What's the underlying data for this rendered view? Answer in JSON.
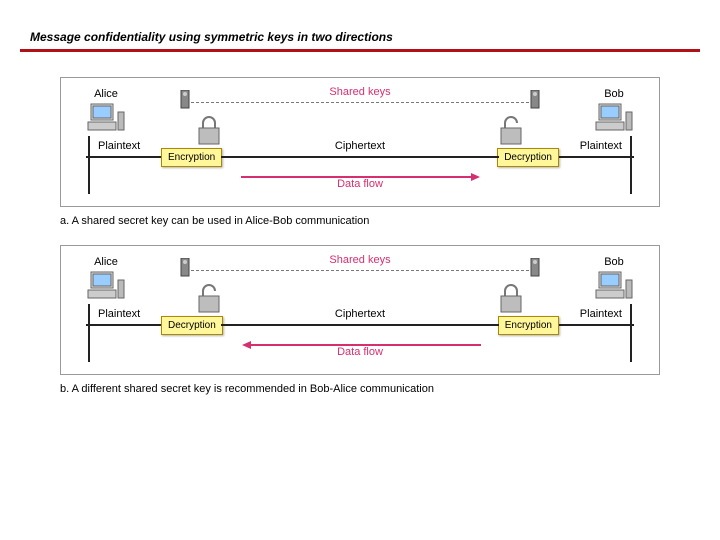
{
  "title": "Message confidentiality using symmetric keys in two directions",
  "panel_a": {
    "alice": "Alice",
    "bob": "Bob",
    "shared_keys": "Shared keys",
    "plaintext_left": "Plaintext",
    "plaintext_right": "Plaintext",
    "ciphertext": "Ciphertext",
    "encryption": "Encryption",
    "decryption": "Decryption",
    "dataflow": "Data flow",
    "caption": "a. A shared secret key can be used in Alice-Bob communication"
  },
  "panel_b": {
    "alice": "Alice",
    "bob": "Bob",
    "shared_keys": "Shared keys",
    "plaintext_left": "Plaintext",
    "plaintext_right": "Plaintext",
    "ciphertext": "Ciphertext",
    "encryption": "Encryption",
    "decryption": "Decryption",
    "dataflow": "Data flow",
    "caption": "b. A different shared secret key is recommended in  Bob-Alice communication"
  }
}
